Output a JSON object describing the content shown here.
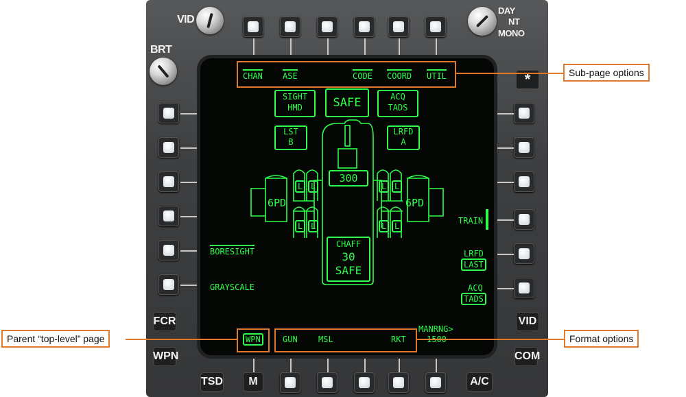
{
  "bezel": {
    "knobs": {
      "vid": "VID",
      "brt": "BRT",
      "day": "DAY",
      "nt": "NT",
      "mono": "MONO"
    },
    "star": "*",
    "left_buttons": {
      "fcr": "FCR",
      "wpn": "WPN"
    },
    "bottom_buttons": {
      "tsd": "TSD",
      "m": "M",
      "ac": "A/C"
    },
    "right_buttons": {
      "vid": "VID",
      "com": "COM"
    }
  },
  "display": {
    "top_options": [
      "CHAN",
      "ASE",
      "CODE",
      "COORD",
      "UTIL"
    ],
    "sight_label": "SIGHT\nHMD",
    "safe_label": "SAFE",
    "acq_label": "ACQ\nTADS",
    "lst_label": "LST\nB",
    "lrfd_label": "LRFD\nA",
    "gun_rounds": "300",
    "pod_left": "6PD",
    "pod_right": "6PD",
    "missile_l": "L",
    "chaff_label": "CHAFF",
    "chaff_count": "30",
    "chaff_state": "SAFE",
    "boresight": "BORESIGHT",
    "grayscale": "GRAYSCALE",
    "train": "TRAIN",
    "lrfd_last_1": "LRFD",
    "lrfd_last_2": "LAST",
    "acq_tads_1": "ACQ",
    "acq_tads_2": "TADS",
    "wpn_page": "WPN",
    "format_options": [
      "GUN",
      "MSL",
      "RKT"
    ],
    "manrng_1": "MANRNG>",
    "manrng_2": "1500"
  },
  "callouts": {
    "subpage": "Sub-page options",
    "parent": "Parent “top-level” page",
    "format": "Format options"
  },
  "colors": {
    "symbology": "#2dff4a",
    "callout": "#e07b2d"
  }
}
